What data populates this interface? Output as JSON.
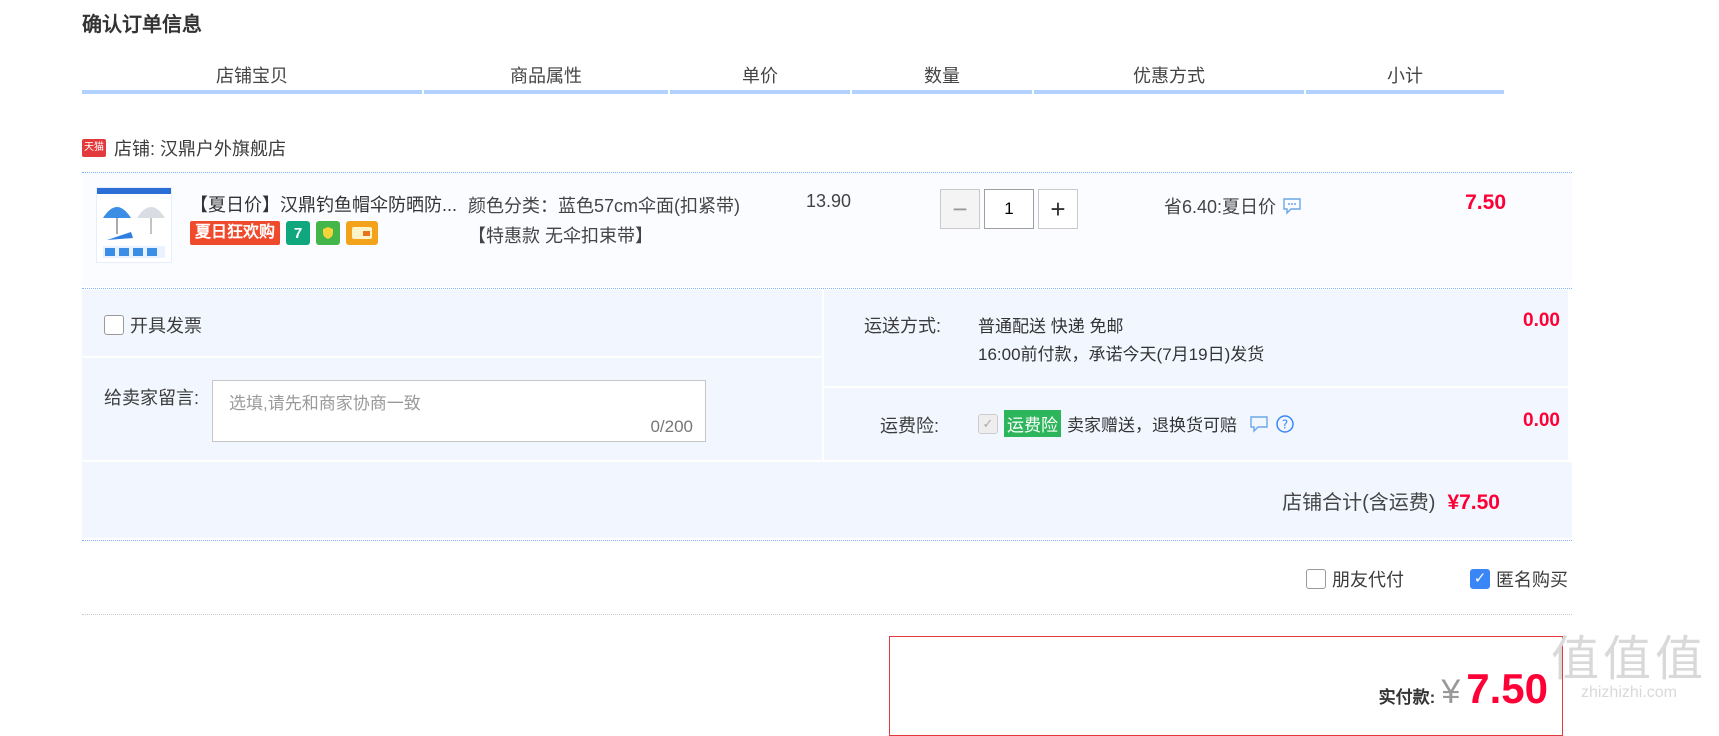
{
  "page": {
    "title": "确认订单信息"
  },
  "table_headers": [
    "店铺宝贝",
    "商品属性",
    "单价",
    "数量",
    "优惠方式",
    "小计"
  ],
  "shop": {
    "badge": "天猫",
    "label": "店铺: 汉鼎户外旗舰店"
  },
  "item": {
    "title": "【夏日价】汉鼎钓鱼帽伞防晒防...",
    "promo_badge": "夏日狂欢购",
    "badge_7": "7",
    "attr": "颜色分类：蓝色57cm伞面(扣紧带)【特惠款 无伞扣束带】",
    "unit_price": "13.90",
    "qty_minus": "−",
    "qty_value": "1",
    "qty_plus": "+",
    "discount": "省6.40:夏日价",
    "subtotal": "7.50"
  },
  "invoice": {
    "label": "开具发票"
  },
  "memo": {
    "label": "给卖家留言:",
    "placeholder": "选填,请先和商家协商一致",
    "counter": "0/200"
  },
  "shipping": {
    "label": "运送方式:",
    "method": "普通配送 快递 免邮",
    "promise": "16:00前付款，承诺今天(7月19日)发货",
    "fee": "0.00"
  },
  "insurance": {
    "label": "运费险:",
    "tag": "运费险",
    "desc": "卖家赠送，退换货可赔",
    "fee": "0.00"
  },
  "shop_total": {
    "label": "店铺合计(含运费)",
    "value": "¥7.50"
  },
  "options": {
    "friend_pay": "朋友代付",
    "anonymous": "匿名购买"
  },
  "final": {
    "label": "实付款:",
    "currency": "¥",
    "amount": "7.50"
  },
  "watermark": {
    "glyphs": "值值值",
    "domain": "zhizhizhi.com"
  },
  "colors": {
    "accent_red": "#ff0036",
    "header_border": "#b2d1ff",
    "panel_bg": "#f2f7ff",
    "checkbox_blue": "#3b86f7",
    "insurance_green": "#2cb55a"
  }
}
